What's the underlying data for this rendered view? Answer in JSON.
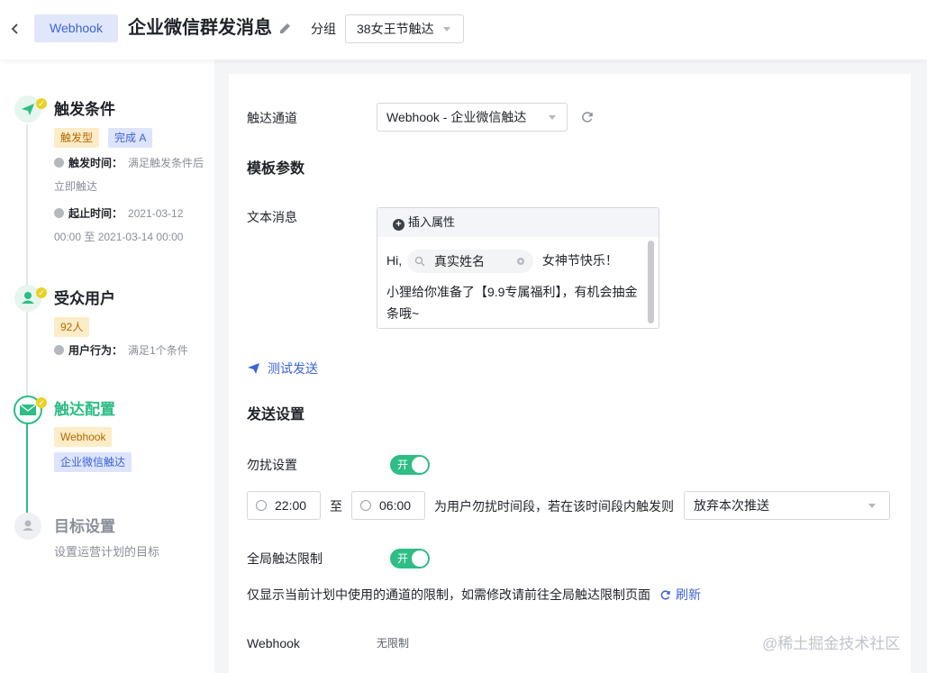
{
  "header": {
    "back_icon": "chevron-left-icon",
    "channel_chip": "Webhook",
    "title": "企业微信群发消息",
    "edit_icon": "pencil-icon",
    "group_label": "分组",
    "group_value": "38女王节触达"
  },
  "sidebar": {
    "steps": [
      {
        "icon": "paper-plane-icon",
        "title": "触发条件",
        "tags": [
          "触发型",
          "完成 A"
        ],
        "rows": [
          {
            "label": "触发时间：",
            "value": "满足触发条件后",
            "value2": "立即触达"
          },
          {
            "label": "起止时间：",
            "value": "2021-03-12",
            "value2": "00:00 至 2021-03-14 00:00"
          }
        ]
      },
      {
        "icon": "user-icon",
        "title": "受众用户",
        "tags": [
          "92人"
        ],
        "rows": [
          {
            "label": "用户行为：",
            "value": "满足1个条件"
          }
        ]
      },
      {
        "icon": "envelope-icon",
        "title": "触达配置",
        "tags": [
          "Webhook",
          "企业微信触达"
        ]
      },
      {
        "icon": "user-circle-icon",
        "title": "目标设置",
        "desc": "设置运营计划的目标"
      }
    ]
  },
  "main": {
    "channel_label": "触达通道",
    "channel_value": "Webhook - 企业微信触达",
    "template_section": "模板参数",
    "text_msg_label": "文本消息",
    "insert_attr": "插入属性",
    "msg_hi": "Hi,",
    "attr_chip": "真实姓名",
    "msg_greeting": "女神节快乐！",
    "msg_line2": "小狸给你准备了【9.9专属福利】，有机会抽金条哦~",
    "test_send": "测试发送",
    "send_section": "发送设置",
    "dnd_label": "勿扰设置",
    "switch_on": "开",
    "dnd_start": "22:00",
    "dnd_to": "至",
    "dnd_end": "06:00",
    "dnd_desc": "为用户勿扰时间段，若在该时间段内触发则",
    "dnd_action": "放弃本次推送",
    "global_limit_label": "全局触达限制",
    "limit_note": "仅显示当前计划中使用的通道的限制，如需修改请前往全局触达限制页面",
    "refresh": "刷新",
    "limit_channel": "Webhook",
    "limit_value": "无限制"
  },
  "watermark": "@稀土掘金技术社区",
  "colors": {
    "accent_green": "#2dbd85",
    "accent_blue": "#3c63d8",
    "check_yellow": "#e8d324"
  }
}
